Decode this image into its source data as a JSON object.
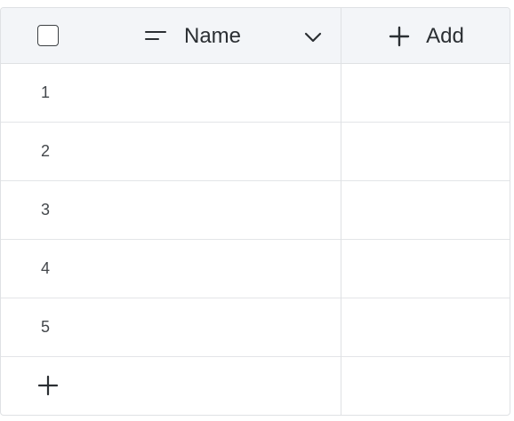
{
  "header": {
    "name_label": "Name",
    "add_label": "Add"
  },
  "rows": [
    "1",
    "2",
    "3",
    "4",
    "5"
  ],
  "icons": {
    "select_all": "checkbox-icon",
    "name_field": "text-field-icon",
    "name_menu": "chevron-down-icon",
    "add_column": "plus-icon",
    "add_row": "plus-icon"
  }
}
